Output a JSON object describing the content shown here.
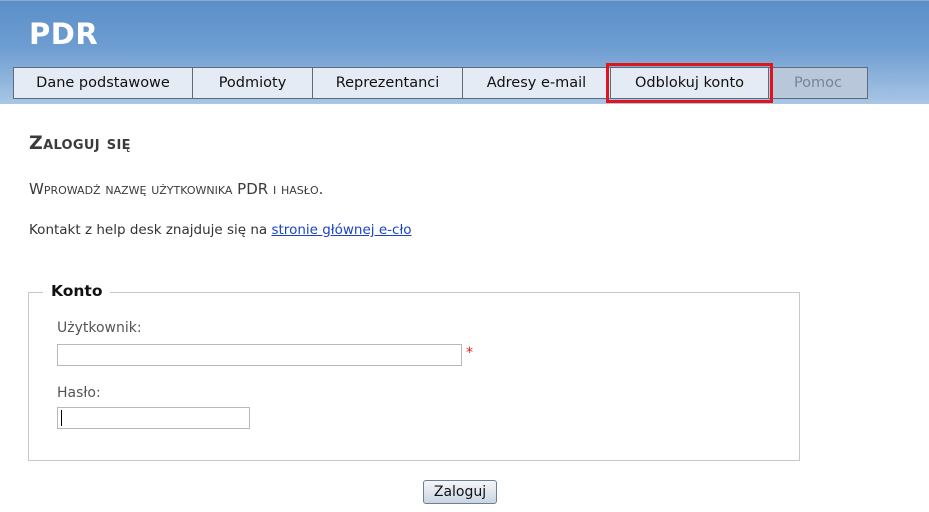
{
  "header": {
    "app_title": "PDR"
  },
  "tabs": [
    {
      "label": "Dane podstawowe",
      "state": "normal"
    },
    {
      "label": "Podmioty",
      "state": "normal"
    },
    {
      "label": "Reprezentanci",
      "state": "normal"
    },
    {
      "label": "Adresy e-mail",
      "state": "normal"
    },
    {
      "label": "Odblokuj konto",
      "state": "highlighted"
    },
    {
      "label": "Pomoc",
      "state": "disabled"
    }
  ],
  "main": {
    "title": "Zaloguj się",
    "subtitle": "Wprowadź nazwę użytkownika PDR i hasło.",
    "contact_text": "Kontakt z help desk znajduje się na",
    "contact_link": "stronie głównej e-cło"
  },
  "form": {
    "legend": "Konto",
    "username_label": "Użytkownik:",
    "username_value": "",
    "required_marker": "*",
    "password_label": "Hasło:",
    "password_value": "",
    "submit_label": "Zaloguj"
  },
  "colors": {
    "header_gradient_top": "#5b8fc9",
    "tab_background": "#e4ebf4",
    "tab_disabled_background": "#b8c8da",
    "highlight_outline": "#e0141c",
    "link": "#1a44c8",
    "required": "#e02020"
  }
}
